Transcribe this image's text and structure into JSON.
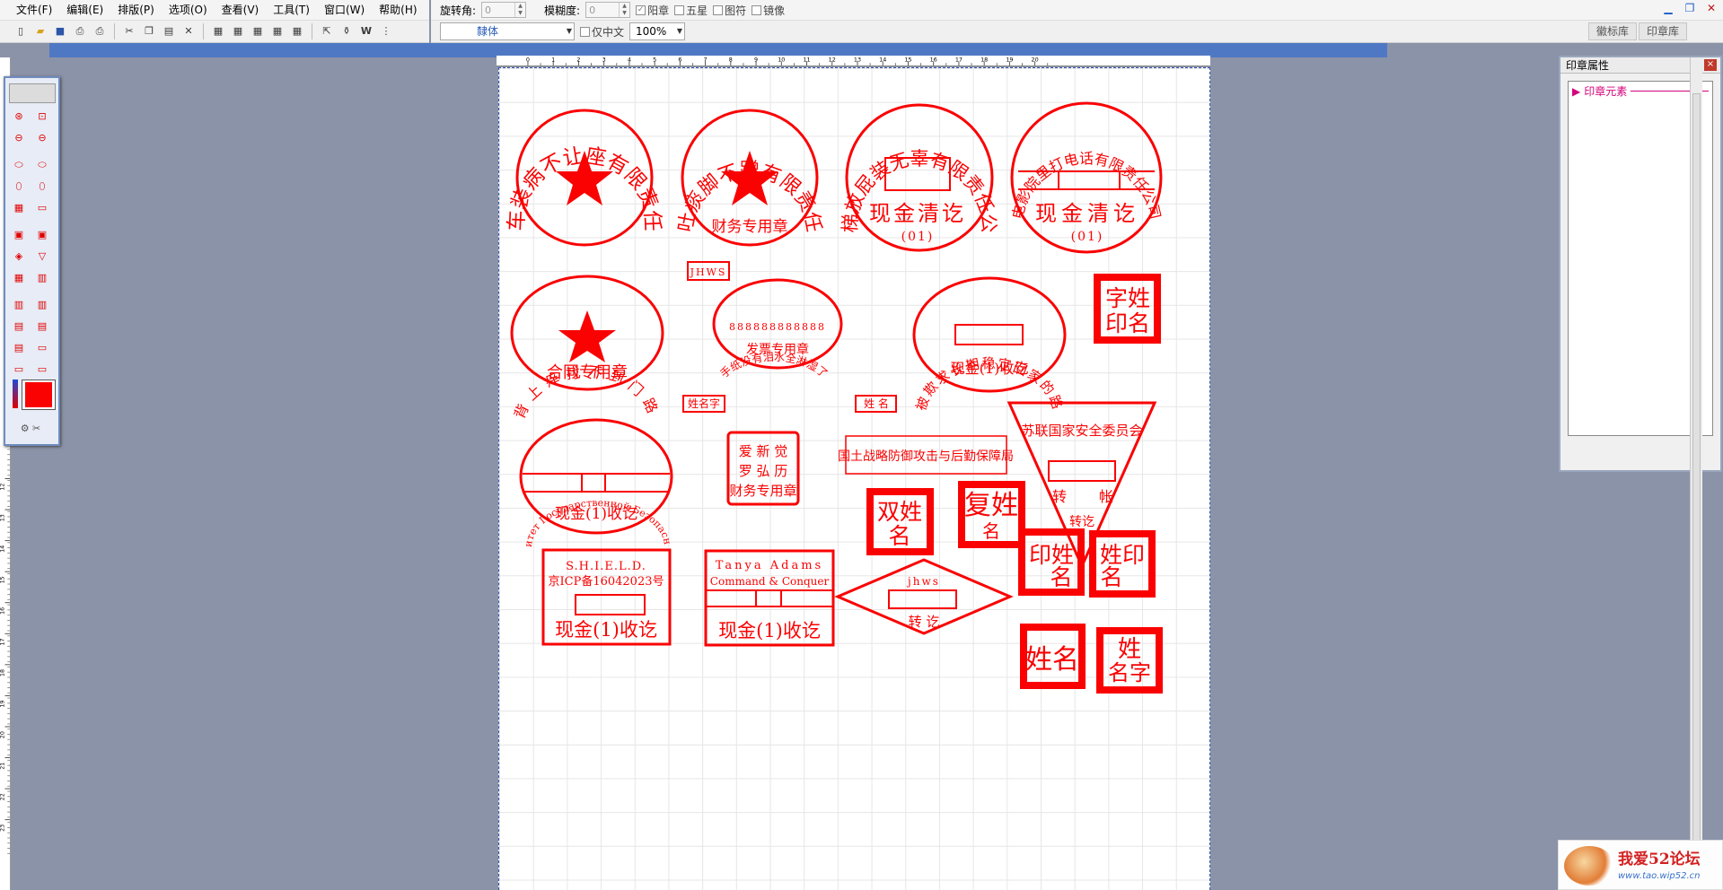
{
  "menu": [
    "文件(F)",
    "编辑(E)",
    "排版(P)",
    "选项(O)",
    "查看(V)",
    "工具(T)",
    "窗口(W)",
    "帮助(H)"
  ],
  "props": {
    "rotate_label": "旋转角:",
    "rotate_value": "0",
    "blur_label": "模糊度:",
    "blur_value": "0",
    "checks": [
      {
        "label": "阳章",
        "checked": true
      },
      {
        "label": "五星",
        "checked": false
      },
      {
        "label": "图符",
        "checked": false
      },
      {
        "label": "镜像",
        "checked": false
      }
    ]
  },
  "toolbar2": {
    "font": "隸体",
    "chinese_only_label": "仅中文",
    "zoom": "100%"
  },
  "tabs": [
    "徽标库",
    "印章库"
  ],
  "panel": {
    "title": "印章属性",
    "element_label": "印章元素"
  },
  "ruler_h": [
    "0",
    "1",
    "2",
    "3",
    "4",
    "5",
    "6",
    "7",
    "8",
    "9",
    "10",
    "11",
    "12",
    "13",
    "14",
    "15",
    "16",
    "17",
    "18",
    "19",
    "20"
  ],
  "ruler_v": [
    "12",
    "13",
    "14",
    "15",
    "16",
    "17",
    "18",
    "19",
    "20",
    "21",
    "22",
    "23"
  ],
  "logo": {
    "title": "我爱52论坛",
    "url": "www.tao.wip52.cn"
  },
  "seal_color": "#fa0202",
  "seals": {
    "s1": {
      "arc": "公交车装病不让座有限责任公司"
    },
    "s2": {
      "arc": "脑地吐痰脚不蹭有限责任公司",
      "bottom": "财务专用章"
    },
    "s3": {
      "arc": "电梯放屁装无辜有限责任公司",
      "main": "现金清讫",
      "num": "(01)"
    },
    "s4": {
      "arc": "电影院里打电话有限责任公司",
      "main": "现金清讫",
      "num": "(01)"
    },
    "s5": {
      "text": "JHWS"
    },
    "s6": {
      "arc": "背上痒找不到门路",
      "bottom": "合同专用章"
    },
    "s7": {
      "arc": "手纸没有泪水全淋湿了",
      "num": "888888888888",
      "bottom": "发票专用章"
    },
    "s8": {
      "arc": "被欺求长期稳定回家的路",
      "bottom": "现金(1)收讫"
    },
    "s9": {
      "l1": "字姓",
      "l2": "印名"
    },
    "s10": {
      "text": "姓名字"
    },
    "s11": {
      "text": "姓 名"
    },
    "s12": {
      "arc": "Комитет Государственной Безопасности",
      "bottom": "现金(1)收讫"
    },
    "s13": {
      "l1": "爱 新 觉",
      "l2": "罗 弘 历",
      "l3": "财务专用章"
    },
    "s14": {
      "text": "国土战略防御攻击与后勤保障局"
    },
    "s15": {
      "top": "苏联国家安全委员会",
      "l": "转",
      "r": "帐",
      "b": "转讫"
    },
    "s16": {
      "l1": "双姓",
      "l2": "名"
    },
    "s17": {
      "l1": "复姓",
      "l2": "名"
    },
    "s18": {
      "l1": "印姓",
      "l2": "名"
    },
    "s19": {
      "l1": "姓印",
      "l2": "名"
    },
    "s20": {
      "l1": "S.H.I.E.L.D.",
      "l2": "京ICP备16042023号",
      "bottom": "现金(1)收讫"
    },
    "s21": {
      "l1": "Tanya Adams",
      "l2": "Command & Conquer",
      "bottom": "现金(1)收讫"
    },
    "s22": {
      "top": "jhws",
      "bottom": "转 讫"
    },
    "s23": {
      "text": "姓名"
    },
    "s24": {
      "l1": "姓",
      "l2": "名字"
    }
  }
}
